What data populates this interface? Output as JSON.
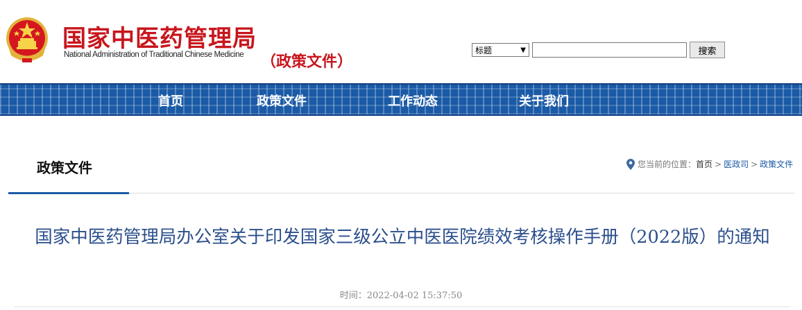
{
  "header": {
    "logo_cn": "国家中医药管理局",
    "logo_en": "National Administration of Traditional Chinese Medicine",
    "section_tag": "（政策文件）",
    "search": {
      "select_value": "标题",
      "input_value": "",
      "button_label": "搜索"
    }
  },
  "nav": {
    "items": [
      {
        "label": "首页"
      },
      {
        "label": "政策文件"
      },
      {
        "label": "工作动态"
      },
      {
        "label": "关于我们"
      }
    ]
  },
  "column": {
    "title": "政策文件"
  },
  "breadcrumb": {
    "prefix": "您当前的位置：",
    "items": [
      "首页",
      "医政司",
      "政策文件"
    ],
    "separator": ">"
  },
  "article": {
    "title": "国家中医药管理局办公室关于印发国家三级公立中医医院绩效考核操作手册（2022版）的通知",
    "time_label": "时间：",
    "time_value": "2022-04-02 15:37:50"
  },
  "colors": {
    "brand_red": "#c8161d",
    "nav_blue": "#1a5aa6",
    "title_blue": "#2b4f8c"
  },
  "icons": {
    "emblem": "national-emblem-icon",
    "location": "location-pin-icon",
    "dropdown": "chevron-down-icon"
  }
}
